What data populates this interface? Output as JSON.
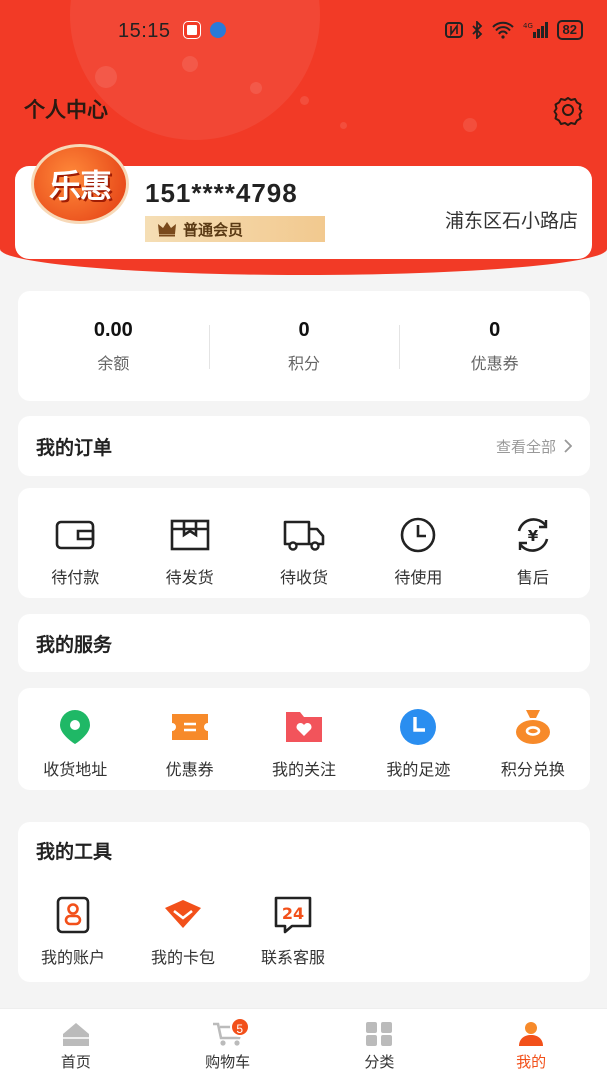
{
  "status_bar": {
    "time": "15:15",
    "battery": "82"
  },
  "header": {
    "title": "个人中心"
  },
  "profile": {
    "avatar_text": "乐惠",
    "phone": "151****4798",
    "member_level": "普通会员",
    "store": "浦东区石小路店"
  },
  "stats": [
    {
      "value": "0.00",
      "label": "余额"
    },
    {
      "value": "0",
      "label": "积分"
    },
    {
      "value": "0",
      "label": "优惠券"
    }
  ],
  "orders": {
    "title": "我的订单",
    "view_all": "查看全部",
    "items": [
      {
        "label": "待付款",
        "icon": "wallet-icon"
      },
      {
        "label": "待发货",
        "icon": "box-icon"
      },
      {
        "label": "待收货",
        "icon": "truck-icon"
      },
      {
        "label": "待使用",
        "icon": "clock-icon"
      },
      {
        "label": "售后",
        "icon": "refund-icon"
      }
    ]
  },
  "services": {
    "title": "我的服务",
    "items": [
      {
        "label": "收货地址",
        "icon": "location-icon",
        "color": "#1fb866"
      },
      {
        "label": "优惠券",
        "icon": "ticket-icon",
        "color": "#f78a2a"
      },
      {
        "label": "我的关注",
        "icon": "heart-folder-icon",
        "color": "#f2545b"
      },
      {
        "label": "我的足迹",
        "icon": "history-icon",
        "color": "#2a8ef0"
      },
      {
        "label": "积分兑换",
        "icon": "money-bag-icon",
        "color": "#f78a2a"
      }
    ]
  },
  "tools": {
    "title": "我的工具",
    "items": [
      {
        "label": "我的账户",
        "icon": "account-icon"
      },
      {
        "label": "我的卡包",
        "icon": "card-pack-icon"
      },
      {
        "label": "联系客服",
        "icon": "support-24-icon"
      }
    ]
  },
  "tabbar": {
    "items": [
      {
        "label": "首页",
        "icon": "home-icon"
      },
      {
        "label": "购物车",
        "icon": "cart-icon",
        "badge": "5"
      },
      {
        "label": "分类",
        "icon": "category-icon"
      },
      {
        "label": "我的",
        "icon": "user-icon",
        "active": true
      }
    ]
  },
  "colors": {
    "accent": "#f23a26",
    "active_tab": "#f2501a"
  }
}
